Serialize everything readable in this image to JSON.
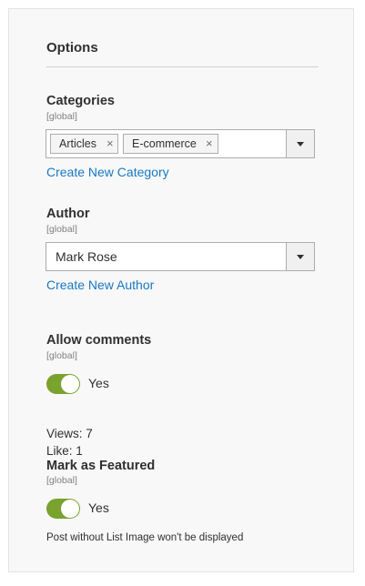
{
  "section": {
    "title": "Options"
  },
  "categories": {
    "label": "Categories",
    "scope": "[global]",
    "tags": [
      {
        "label": "Articles",
        "remove": "×"
      },
      {
        "label": "E-commerce",
        "remove": "×"
      }
    ],
    "create_link": "Create New Category"
  },
  "author": {
    "label": "Author",
    "scope": "[global]",
    "value": "Mark Rose",
    "create_link": "Create New Author"
  },
  "comments": {
    "label": "Allow comments",
    "scope": "[global]",
    "toggle_text": "Yes",
    "enabled": true
  },
  "stats": {
    "views": "Views: 7",
    "likes": "Like: 1"
  },
  "featured": {
    "label": "Mark as Featured",
    "scope": "[global]",
    "toggle_text": "Yes",
    "enabled": true,
    "note": "Post without List Image won't be displayed"
  },
  "colors": {
    "accent": "#79a22e",
    "link": "#1979c3",
    "panel_bg": "#f8f8f8"
  },
  "icons": {
    "dropdown": "chevron-down-icon",
    "remove_tag": "close-icon"
  }
}
